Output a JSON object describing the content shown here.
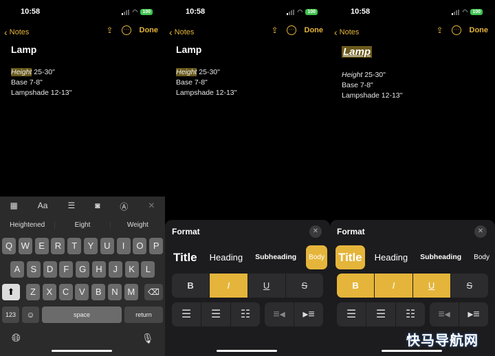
{
  "status": {
    "time": "10:58",
    "battery": "100"
  },
  "nav": {
    "back_label": "Notes",
    "done_label": "Done"
  },
  "note": {
    "title": "Lamp",
    "lines": [
      {
        "label": "Height",
        "value": " 25-30\""
      },
      {
        "label": "Base",
        "value": " 7-8\""
      },
      {
        "label": "Lampshade",
        "value": " 12-13\""
      }
    ]
  },
  "keyboard": {
    "toolbar_icons": [
      "table-icon",
      "text-format-icon",
      "checklist-icon",
      "camera-icon",
      "markup-icon",
      "close-icon"
    ],
    "format_label": "Aa",
    "suggestions": [
      "Heightened",
      "Eight",
      "Weight"
    ],
    "rows": [
      [
        "Q",
        "W",
        "E",
        "R",
        "T",
        "Y",
        "U",
        "I",
        "O",
        "P"
      ],
      [
        "A",
        "S",
        "D",
        "F",
        "G",
        "H",
        "J",
        "K",
        "L"
      ],
      [
        "Z",
        "X",
        "C",
        "V",
        "B",
        "N",
        "M"
      ]
    ],
    "numbers": "123",
    "space": "space",
    "return": "return"
  },
  "format": {
    "title": "Format",
    "styles": [
      "Title",
      "Heading",
      "Subheading",
      "Body"
    ],
    "text_styles": [
      "B",
      "I",
      "U",
      "S"
    ],
    "panel2": {
      "active_style": "Body",
      "active_text": [
        "I"
      ]
    },
    "panel3": {
      "active_style": "Title",
      "active_text": [
        "B",
        "I",
        "U"
      ]
    }
  },
  "colors": {
    "accent": "#e5b53b",
    "background": "#000000",
    "keyboard": "#2b2b2b"
  },
  "watermark": "快马导航网"
}
